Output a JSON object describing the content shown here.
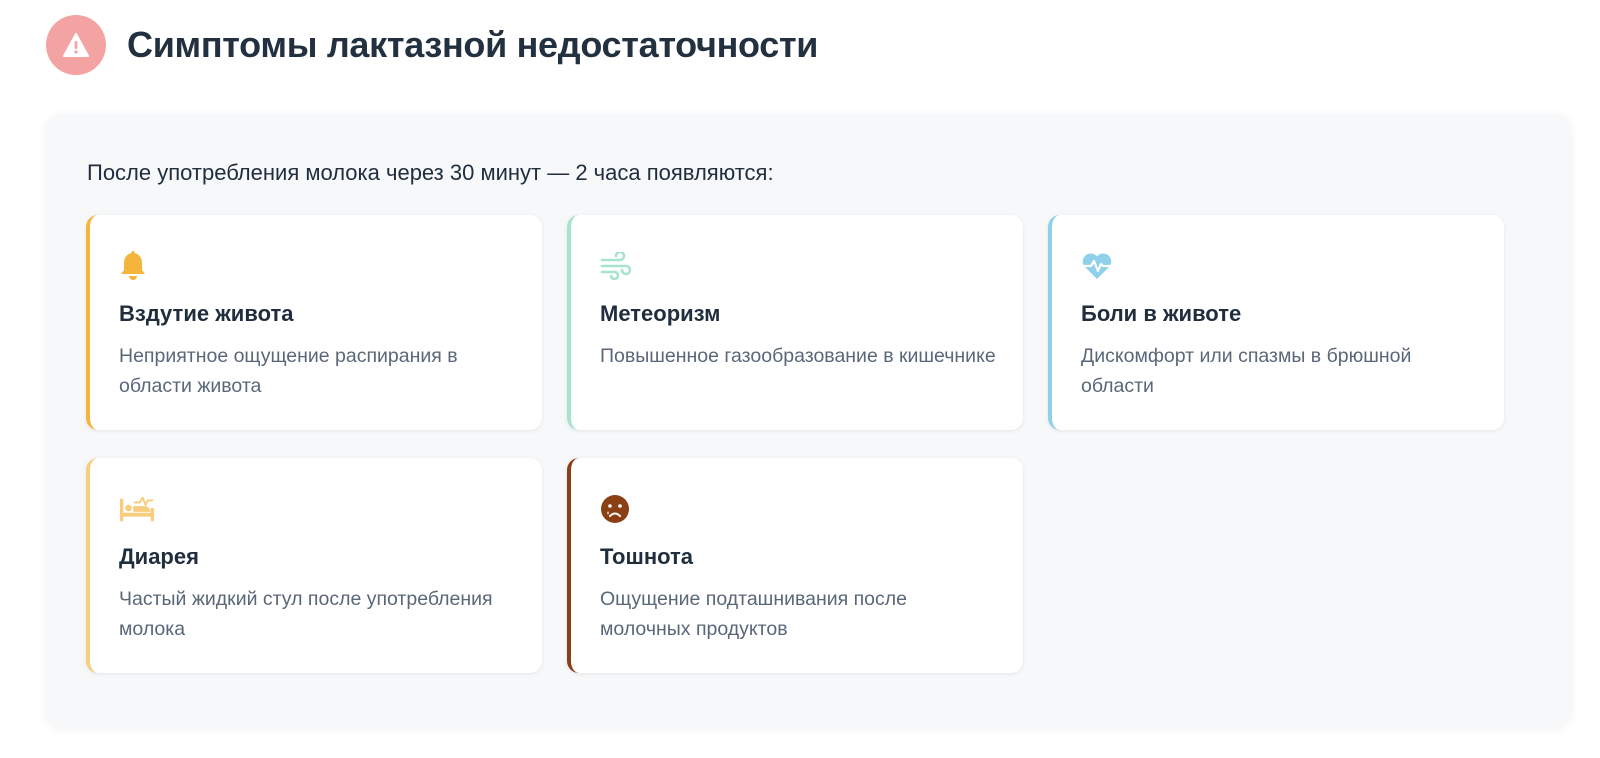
{
  "header": {
    "title": "Симптомы лактазной недостаточности",
    "icon": "warning-icon",
    "icon_bg": "#f4a3a3"
  },
  "panel": {
    "intro": "После употребления молока через 30 минут — 2 часа появляются:"
  },
  "symptoms": [
    {
      "title": "Вздутие живота",
      "description": "Неприятное ощущение распирания в области живота",
      "icon": "bell-icon",
      "accent": "#f5b43c"
    },
    {
      "title": "Метеоризм",
      "description": "Повышенное газообразование в кишечнике",
      "icon": "wind-icon",
      "accent": "#a8e3d0"
    },
    {
      "title": "Боли в животе",
      "description": "Дискомфорт или спазмы в брюшной области",
      "icon": "heartbeat-icon",
      "accent": "#8fd0ea"
    },
    {
      "title": "Диарея",
      "description": "Частый жидкий стул после употребления молока",
      "icon": "bed-icon",
      "accent": "#f8cd7e"
    },
    {
      "title": "Тошнота",
      "description": "Ощущение подташнивания после молочных продуктов",
      "icon": "sad-face-icon",
      "accent": "#8b3f14"
    }
  ]
}
